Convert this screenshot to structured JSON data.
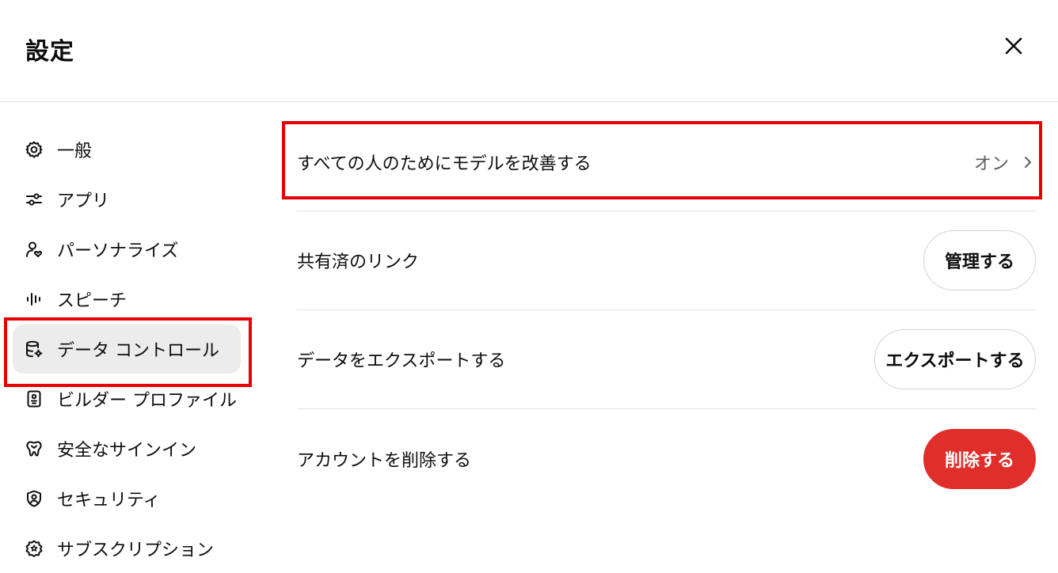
{
  "header": {
    "title": "設定"
  },
  "sidebar": {
    "items": [
      {
        "label": "一般",
        "icon": "gear-icon"
      },
      {
        "label": "アプリ",
        "icon": "sliders-icon"
      },
      {
        "label": "パーソナライズ",
        "icon": "person-heart-icon"
      },
      {
        "label": "スピーチ",
        "icon": "waveform-icon"
      },
      {
        "label": "データ コントロール",
        "icon": "database-gear-icon",
        "active": true
      },
      {
        "label": "ビルダー プロファイル",
        "icon": "id-card-icon"
      },
      {
        "label": "安全なサインイン",
        "icon": "passkey-icon"
      },
      {
        "label": "セキュリティ",
        "icon": "shield-user-icon"
      },
      {
        "label": "サブスクリプション",
        "icon": "badge-star-icon"
      }
    ]
  },
  "main": {
    "rows": [
      {
        "label": "すべての人のためにモデルを改善する",
        "value": "オン"
      },
      {
        "label": "共有済のリンク",
        "button": "管理する"
      },
      {
        "label": "データをエクスポートする",
        "button": "エクスポートする"
      },
      {
        "label": "アカウントを削除する",
        "button": "削除する"
      }
    ]
  },
  "colors": {
    "accent_danger": "#e02e2a",
    "highlight_box": "#e60000",
    "active_bg": "#ececec"
  }
}
